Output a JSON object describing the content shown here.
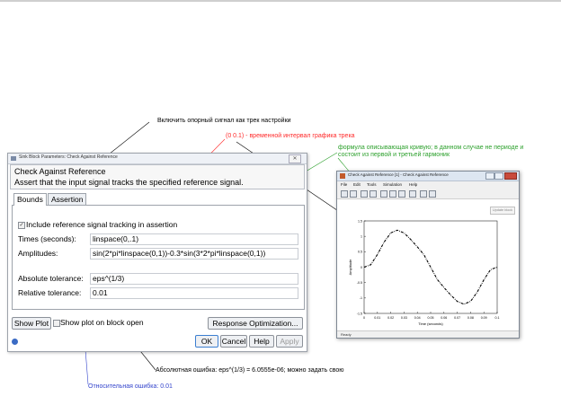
{
  "annotations": {
    "a1": "Включить опорный сигнал как трек настройки",
    "a2": "(0  0.1) - временной интервал графика трека",
    "a3_line1": "формула описывающая кривую; в данном случае не периоде и",
    "a3_line2": "состоит из первой и третьей гармоник",
    "a4": "Абсолютная ошибка:  eps^(1/3) = 6.0555e-06;   можно задать свою",
    "a5": "Относительная ошибка:  0.01",
    "colors": {
      "a1": "#000000",
      "a2": "#ff2a2a",
      "a3": "#2ca02c",
      "a4": "#000000",
      "a5": "#3344cc"
    }
  },
  "dialog": {
    "title": "Sink Block Parameters: Check Against Reference",
    "close_glyph": "✕",
    "heading": "Check Against Reference",
    "description": "Assert that the input signal tracks the specified reference signal.",
    "tabs": [
      {
        "label": "Bounds"
      },
      {
        "label": "Assertion"
      }
    ],
    "include_checkbox": {
      "label": "Include reference signal tracking in assertion",
      "checked": true,
      "glyph": "✓"
    },
    "times": {
      "label": "Times (seconds):",
      "value": "linspace(0,.1)"
    },
    "amplitudes": {
      "label": "Amplitudes:",
      "value": "sin(2*pi*linspace(0,1))-0.3*sin(3*2*pi*linspace(0,1))"
    },
    "abs_tol": {
      "label": "Absolute tolerance:",
      "value": "eps^(1/3)"
    },
    "rel_tol": {
      "label": "Relative tolerance:",
      "value": "0.01"
    },
    "show_plot_button": "Show Plot",
    "show_plot_open": {
      "label": "Show plot on block open",
      "checked": false
    },
    "response_opt_button": "Response Optimization...",
    "ok": "OK",
    "cancel": "Cancel",
    "help": "Help",
    "apply": "Apply"
  },
  "figure": {
    "title": "Check Against Reference [1] - Check Against Reference",
    "menu": [
      "File",
      "Edit",
      "Tools",
      "Simulation",
      "Help"
    ],
    "update_button": "Update block",
    "status": "Ready"
  },
  "chart_data": {
    "type": "line",
    "title": "",
    "xlabel": "Time (seconds)",
    "ylabel": "Amplitude",
    "xlim": [
      0,
      0.1
    ],
    "ylim": [
      -1.5,
      1.5
    ],
    "xticks": [
      "0",
      "0.01",
      "0.02",
      "0.03",
      "0.04",
      "0.05",
      "0.06",
      "0.07",
      "0.08",
      "0.09",
      "0.1"
    ],
    "yticks": [
      "1.5",
      "1",
      "0.5",
      "0",
      "-0.5",
      "-1",
      "-1.5"
    ],
    "grid": false,
    "series": [
      {
        "style": "dash-dot",
        "color": "#000000",
        "x": [
          0,
          0.005,
          0.01,
          0.015,
          0.02,
          0.025,
          0.03,
          0.035,
          0.04,
          0.045,
          0.05,
          0.055,
          0.06,
          0.065,
          0.07,
          0.075,
          0.08,
          0.085,
          0.09,
          0.095,
          0.1
        ],
        "y": [
          0,
          0.08,
          0.41,
          0.81,
          1.11,
          1.2,
          1.11,
          0.9,
          0.66,
          0.4,
          0,
          -0.4,
          -0.66,
          -0.9,
          -1.11,
          -1.2,
          -1.11,
          -0.81,
          -0.41,
          -0.08,
          0
        ]
      }
    ]
  }
}
